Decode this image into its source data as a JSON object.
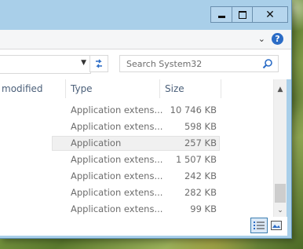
{
  "window": {
    "caption": {
      "close_label": "✕"
    }
  },
  "ribbon": {
    "expand_glyph": "⌄",
    "help_glyph": "?"
  },
  "address": {
    "dropdown_glyph": "▼"
  },
  "search": {
    "placeholder": "Search System32"
  },
  "columns": {
    "modified": "modified",
    "type": "Type",
    "size": "Size"
  },
  "rows": [
    {
      "type": "Application extens...",
      "size": "10 746 KB"
    },
    {
      "type": "Application extens...",
      "size": "598 KB"
    },
    {
      "type": "Application",
      "size": "257 KB",
      "selected": true
    },
    {
      "type": "Application extens...",
      "size": "1 507 KB"
    },
    {
      "type": "Application extens...",
      "size": "242 KB"
    },
    {
      "type": "Application extens...",
      "size": "282 KB"
    },
    {
      "type": "Application extens...",
      "size": "99 KB"
    }
  ],
  "scrollbar": {
    "up_glyph": "▲",
    "down_glyph": "⌄"
  },
  "colors": {
    "titlebar": "#a9cfe9",
    "accent": "#2b6cc6",
    "header_text": "#4c607a",
    "row_text": "#6d6d6d"
  }
}
